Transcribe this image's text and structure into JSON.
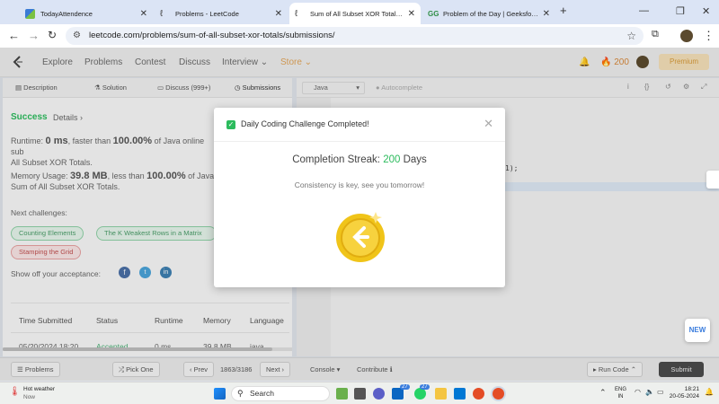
{
  "tabs": [
    {
      "title": "TodayAttendence",
      "active": false
    },
    {
      "title": "Problems - LeetCode",
      "active": false
    },
    {
      "title": "Sum of All Subset XOR Totals - Lee",
      "active": true
    },
    {
      "title": "Problem of the Day | GeeksforGee",
      "active": false
    }
  ],
  "address": {
    "url": "leetcode.com/problems/sum-of-all-subset-xor-totals/submissions/"
  },
  "lcnav": {
    "items": [
      "Explore",
      "Problems",
      "Contest",
      "Discuss",
      "Interview",
      "Store"
    ],
    "fire_count": "200",
    "premium": "Premium"
  },
  "subtabs": [
    "Description",
    "Solution",
    "Discuss (999+)",
    "Submissions"
  ],
  "editor": {
    "language": "Java",
    "autocomplete": "Autocomplete",
    "code_tail": "1);"
  },
  "result": {
    "status": "Success",
    "details": "Details",
    "runtime_label": "Runtime:",
    "runtime_value": "0 ms",
    "runtime_mid": ", faster than",
    "runtime_pct": "100.00%",
    "runtime_tail": "of Java online sub",
    "runtime_line2": "All Subset XOR Totals.",
    "memory_label": "Memory Usage:",
    "memory_value": "39.8 MB",
    "memory_mid": ", less than",
    "memory_pct": "100.00%",
    "memory_tail": "of Java",
    "memory_line2": "Sum of All Subset XOR Totals."
  },
  "next_challenges": {
    "label": "Next challenges:",
    "chips": [
      "Counting Elements",
      "The K Weakest Rows in a Matrix",
      "Stamping the Grid"
    ]
  },
  "share_label": "Show off your acceptance:",
  "table": {
    "headers": [
      "Time Submitted",
      "Status",
      "Runtime",
      "Memory",
      "Language"
    ],
    "row": [
      "05/20/2024 18:20",
      "Accepted",
      "0 ms",
      "39.8 MB",
      "java"
    ]
  },
  "bottom": {
    "problems": "Problems",
    "pick_one": "Pick One",
    "prev": "Prev",
    "page": "1863/3186",
    "next": "Next",
    "console": "Console",
    "contribute": "Contribute",
    "run_code": "Run Code",
    "submit": "Submit"
  },
  "modal": {
    "title": "Daily Coding Challenge Completed!",
    "streak_label": "Completion Streak:",
    "streak_value": "200",
    "streak_unit": "Days",
    "message": "Consistency is key, see you tomorrow!"
  },
  "new_badge": "NEW",
  "taskbar": {
    "weather_title": "Hot weather",
    "weather_sub": "Now",
    "search": "Search",
    "lang_top": "ENG",
    "lang_bottom": "IN",
    "time": "18:21",
    "date": "20-05-2024",
    "badge_a": "27",
    "badge_b": "27"
  },
  "colors": {
    "accent_green": "#2cbb5d",
    "brand_orange": "#ffa116",
    "chrome_blue": "#dbe4f5"
  }
}
